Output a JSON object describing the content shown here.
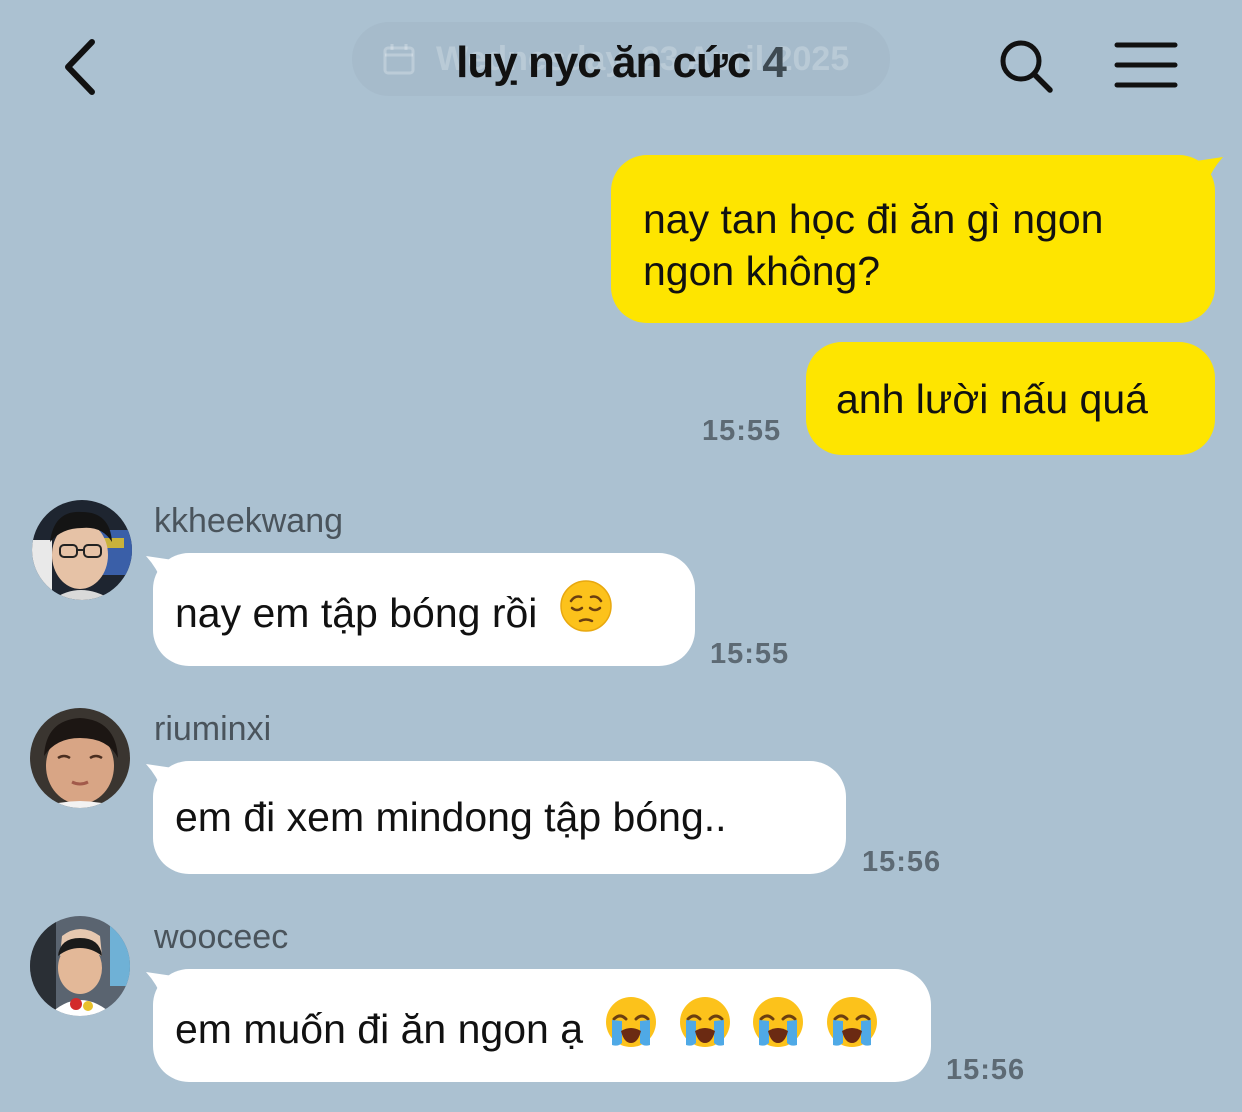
{
  "header": {
    "date_hint": "Wednesday, 23 April 2025",
    "title": "luỵ nyc ăn cức",
    "member_count": "4"
  },
  "messages": [
    {
      "line1": "nay tan học đi ăn gì ngon",
      "line2": "ngon không?"
    },
    {
      "text": "anh lười nấu quá",
      "time": "15:55"
    },
    {
      "sender": "kkheekwang",
      "text": "nay em tập bóng rồi",
      "time": "15:55"
    },
    {
      "sender": "riuminxi",
      "text": "em đi xem mindong tập bóng..",
      "time": "15:56"
    },
    {
      "sender": "wooceec",
      "text": "em muốn đi ăn ngon ạ",
      "time": "15:56"
    }
  ],
  "icons": {
    "back": "chevron-left-icon",
    "search": "search-icon",
    "menu": "hamburger-menu-icon",
    "pensive_emoji": "pensive-face-emoji",
    "crying_emoji": "loudly-crying-face-emoji"
  },
  "colors": {
    "background": "#abc1d1",
    "my_bubble": "#fee500",
    "their_bubble": "#ffffff",
    "timestamp": "#5d6a74"
  }
}
